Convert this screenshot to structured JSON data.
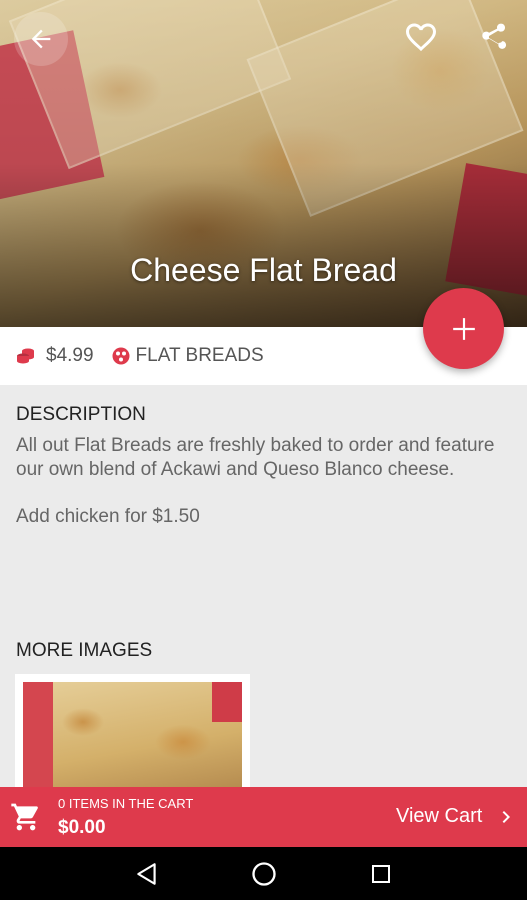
{
  "hero": {
    "title": "Cheese Flat Bread"
  },
  "item": {
    "price": "$4.99",
    "category": "FLAT BREADS"
  },
  "description": {
    "heading": "DESCRIPTION",
    "text": "All out Flat Breads are freshly baked to order and feature our own blend of Ackawi and Queso Blanco cheese.",
    "extra": "Add chicken for $1.50"
  },
  "more_images": {
    "heading": "MORE IMAGES"
  },
  "cart": {
    "count_label": "0 ITEMS IN THE CART",
    "total": "$0.00",
    "view_label": "View Cart"
  },
  "colors": {
    "accent": "#de3a4c"
  },
  "icons": [
    "arrow-back-icon",
    "heart-icon",
    "share-icon",
    "plus-icon",
    "price-tag-icon",
    "category-icon",
    "cart-icon",
    "chevron-right-icon",
    "nav-back-icon",
    "nav-home-icon",
    "nav-recents-icon"
  ]
}
